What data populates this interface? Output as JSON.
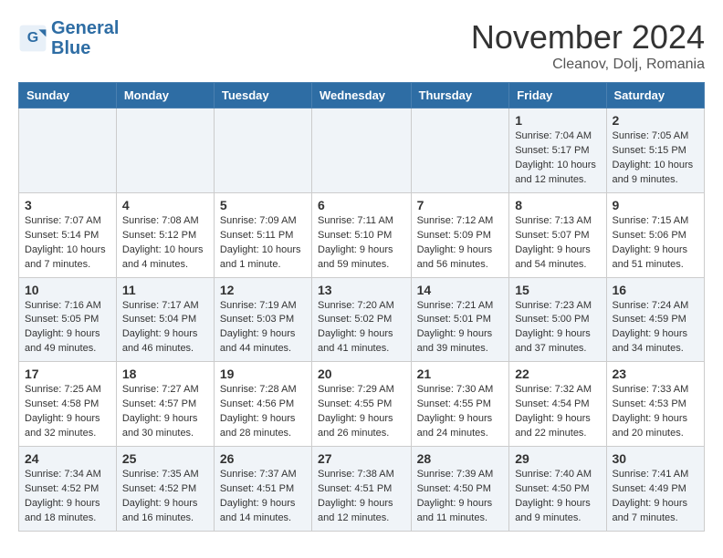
{
  "logo": {
    "line1": "General",
    "line2": "Blue"
  },
  "title": "November 2024",
  "location": "Cleanov, Dolj, Romania",
  "weekdays": [
    "Sunday",
    "Monday",
    "Tuesday",
    "Wednesday",
    "Thursday",
    "Friday",
    "Saturday"
  ],
  "weeks": [
    [
      {
        "day": "",
        "info": ""
      },
      {
        "day": "",
        "info": ""
      },
      {
        "day": "",
        "info": ""
      },
      {
        "day": "",
        "info": ""
      },
      {
        "day": "",
        "info": ""
      },
      {
        "day": "1",
        "info": "Sunrise: 7:04 AM\nSunset: 5:17 PM\nDaylight: 10 hours and 12 minutes."
      },
      {
        "day": "2",
        "info": "Sunrise: 7:05 AM\nSunset: 5:15 PM\nDaylight: 10 hours and 9 minutes."
      }
    ],
    [
      {
        "day": "3",
        "info": "Sunrise: 7:07 AM\nSunset: 5:14 PM\nDaylight: 10 hours and 7 minutes."
      },
      {
        "day": "4",
        "info": "Sunrise: 7:08 AM\nSunset: 5:12 PM\nDaylight: 10 hours and 4 minutes."
      },
      {
        "day": "5",
        "info": "Sunrise: 7:09 AM\nSunset: 5:11 PM\nDaylight: 10 hours and 1 minute."
      },
      {
        "day": "6",
        "info": "Sunrise: 7:11 AM\nSunset: 5:10 PM\nDaylight: 9 hours and 59 minutes."
      },
      {
        "day": "7",
        "info": "Sunrise: 7:12 AM\nSunset: 5:09 PM\nDaylight: 9 hours and 56 minutes."
      },
      {
        "day": "8",
        "info": "Sunrise: 7:13 AM\nSunset: 5:07 PM\nDaylight: 9 hours and 54 minutes."
      },
      {
        "day": "9",
        "info": "Sunrise: 7:15 AM\nSunset: 5:06 PM\nDaylight: 9 hours and 51 minutes."
      }
    ],
    [
      {
        "day": "10",
        "info": "Sunrise: 7:16 AM\nSunset: 5:05 PM\nDaylight: 9 hours and 49 minutes."
      },
      {
        "day": "11",
        "info": "Sunrise: 7:17 AM\nSunset: 5:04 PM\nDaylight: 9 hours and 46 minutes."
      },
      {
        "day": "12",
        "info": "Sunrise: 7:19 AM\nSunset: 5:03 PM\nDaylight: 9 hours and 44 minutes."
      },
      {
        "day": "13",
        "info": "Sunrise: 7:20 AM\nSunset: 5:02 PM\nDaylight: 9 hours and 41 minutes."
      },
      {
        "day": "14",
        "info": "Sunrise: 7:21 AM\nSunset: 5:01 PM\nDaylight: 9 hours and 39 minutes."
      },
      {
        "day": "15",
        "info": "Sunrise: 7:23 AM\nSunset: 5:00 PM\nDaylight: 9 hours and 37 minutes."
      },
      {
        "day": "16",
        "info": "Sunrise: 7:24 AM\nSunset: 4:59 PM\nDaylight: 9 hours and 34 minutes."
      }
    ],
    [
      {
        "day": "17",
        "info": "Sunrise: 7:25 AM\nSunset: 4:58 PM\nDaylight: 9 hours and 32 minutes."
      },
      {
        "day": "18",
        "info": "Sunrise: 7:27 AM\nSunset: 4:57 PM\nDaylight: 9 hours and 30 minutes."
      },
      {
        "day": "19",
        "info": "Sunrise: 7:28 AM\nSunset: 4:56 PM\nDaylight: 9 hours and 28 minutes."
      },
      {
        "day": "20",
        "info": "Sunrise: 7:29 AM\nSunset: 4:55 PM\nDaylight: 9 hours and 26 minutes."
      },
      {
        "day": "21",
        "info": "Sunrise: 7:30 AM\nSunset: 4:55 PM\nDaylight: 9 hours and 24 minutes."
      },
      {
        "day": "22",
        "info": "Sunrise: 7:32 AM\nSunset: 4:54 PM\nDaylight: 9 hours and 22 minutes."
      },
      {
        "day": "23",
        "info": "Sunrise: 7:33 AM\nSunset: 4:53 PM\nDaylight: 9 hours and 20 minutes."
      }
    ],
    [
      {
        "day": "24",
        "info": "Sunrise: 7:34 AM\nSunset: 4:52 PM\nDaylight: 9 hours and 18 minutes."
      },
      {
        "day": "25",
        "info": "Sunrise: 7:35 AM\nSunset: 4:52 PM\nDaylight: 9 hours and 16 minutes."
      },
      {
        "day": "26",
        "info": "Sunrise: 7:37 AM\nSunset: 4:51 PM\nDaylight: 9 hours and 14 minutes."
      },
      {
        "day": "27",
        "info": "Sunrise: 7:38 AM\nSunset: 4:51 PM\nDaylight: 9 hours and 12 minutes."
      },
      {
        "day": "28",
        "info": "Sunrise: 7:39 AM\nSunset: 4:50 PM\nDaylight: 9 hours and 11 minutes."
      },
      {
        "day": "29",
        "info": "Sunrise: 7:40 AM\nSunset: 4:50 PM\nDaylight: 9 hours and 9 minutes."
      },
      {
        "day": "30",
        "info": "Sunrise: 7:41 AM\nSunset: 4:49 PM\nDaylight: 9 hours and 7 minutes."
      }
    ]
  ]
}
